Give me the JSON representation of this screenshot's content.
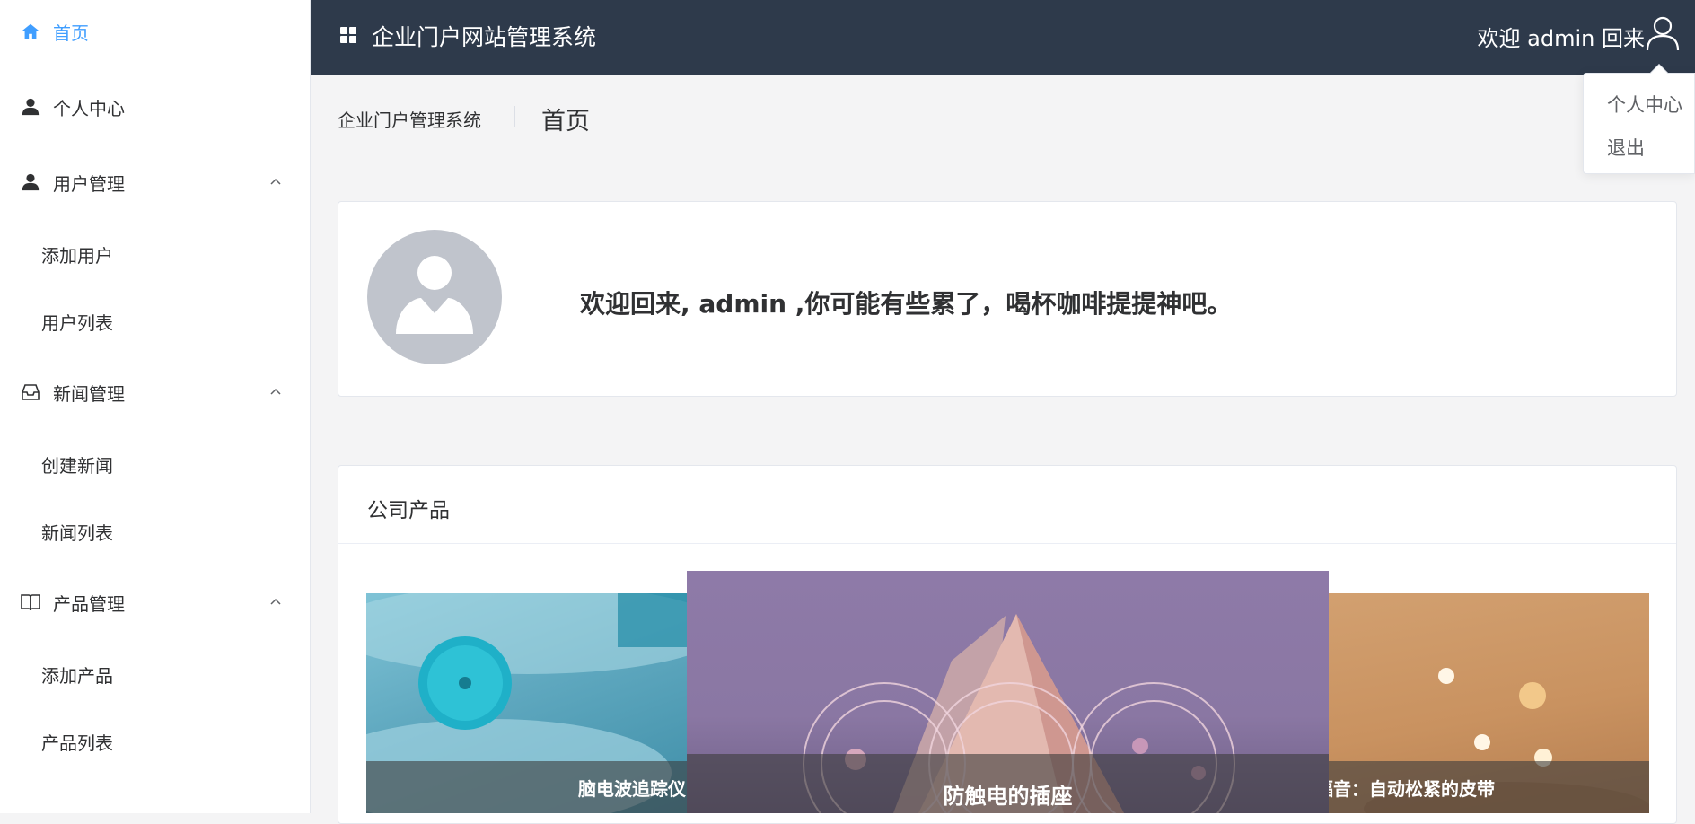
{
  "sidebar": {
    "items": [
      {
        "label": "首页",
        "icon": "home-icon"
      },
      {
        "label": "个人中心",
        "icon": "person-icon"
      },
      {
        "label": "用户管理",
        "icon": "user-icon",
        "children": [
          "添加用户",
          "用户列表"
        ]
      },
      {
        "label": "新闻管理",
        "icon": "inbox-icon",
        "children": [
          "创建新闻",
          "新闻列表"
        ]
      },
      {
        "label": "产品管理",
        "icon": "book-icon",
        "children": [
          "添加产品",
          "产品列表"
        ]
      }
    ]
  },
  "header": {
    "title": "企业门户网站管理系统",
    "welcome": "欢迎 admin 回来"
  },
  "dropdown": {
    "items": [
      "个人中心",
      "退出"
    ]
  },
  "breadcrumb": {
    "root": "企业门户管理系统",
    "current": "首页"
  },
  "welcome_card": {
    "message": "欢迎回来, admin ,你可能有些累了，喝杯咖啡提提神吧。"
  },
  "products": {
    "title": "公司产品",
    "slides": [
      {
        "caption": "脑电波追踪仪"
      },
      {
        "caption": "防触电的插座"
      },
      {
        "caption": "福音：自动松紧的皮带"
      }
    ]
  },
  "colors": {
    "accent": "#409eff",
    "header_bg": "#2e3a4b"
  }
}
